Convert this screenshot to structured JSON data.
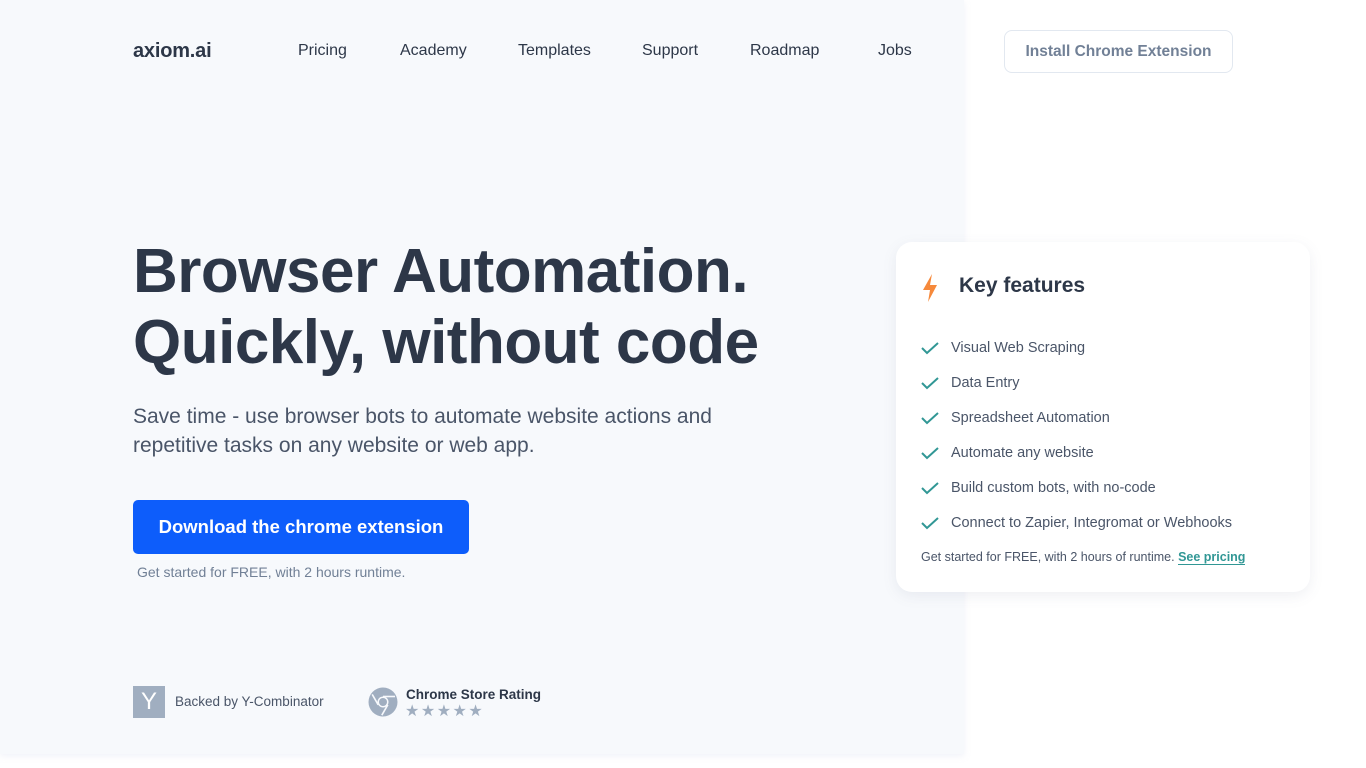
{
  "header": {
    "logo": "axiom.ai",
    "nav": [
      "Pricing",
      "Academy",
      "Templates",
      "Support",
      "Roadmap",
      "Jobs"
    ],
    "install_button": "Install Chrome Extension"
  },
  "hero": {
    "title_line1": "Browser Automation.",
    "title_line2": "Quickly, without code",
    "subtitle": "Save time - use browser bots to automate website actions and repetitive tasks on any website or web app.",
    "cta_button": "Download the chrome extension",
    "cta_note": "Get started for FREE, with 2 hours runtime."
  },
  "badges": {
    "yc_letter": "Y",
    "yc_text": "Backed by Y-Combinator",
    "rating_title": "Chrome Store Rating",
    "rating_stars": "★★★★★"
  },
  "features_card": {
    "title": "Key features",
    "items": [
      "Visual Web Scraping",
      "Data Entry",
      "Spreadsheet Automation",
      "Automate any website",
      "Build custom bots, with no-code",
      "Connect to Zapier, Integromat or Webhooks"
    ],
    "note": "Get started for FREE, with 2 hours of runtime.",
    "note_link": "See pricing"
  },
  "colors": {
    "primary": "#0d5dfb",
    "accent_teal": "#319795",
    "bolt_orange": "#f6893b",
    "text_dark": "#2d3748",
    "muted": "#a0aec0"
  }
}
